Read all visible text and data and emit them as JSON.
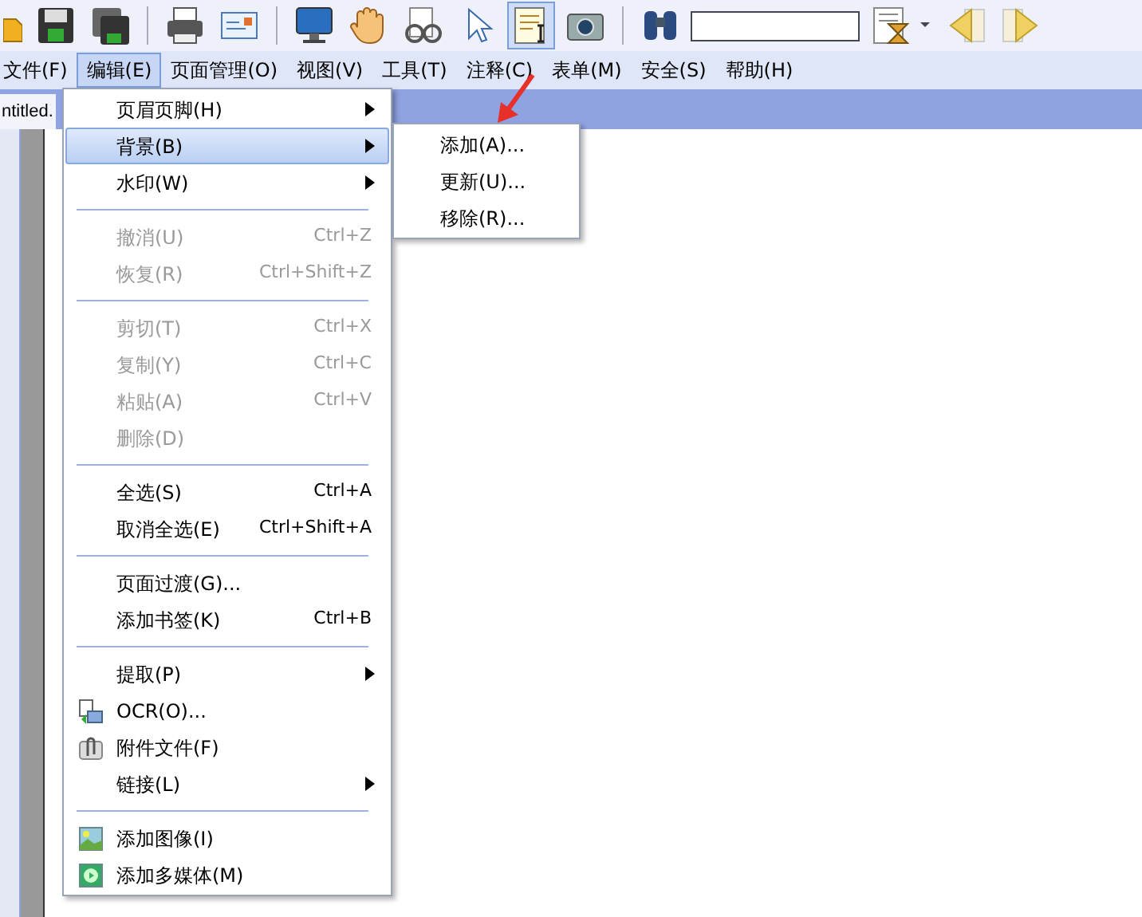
{
  "toolbar": {
    "tools": [
      {
        "kind": "folder",
        "selected": false
      },
      {
        "kind": "save",
        "selected": false
      },
      {
        "kind": "save-all",
        "selected": false
      },
      {
        "kind": "sep"
      },
      {
        "kind": "print",
        "selected": false
      },
      {
        "kind": "mail",
        "selected": false
      },
      {
        "kind": "sep"
      },
      {
        "kind": "monitor",
        "selected": false
      },
      {
        "kind": "hand",
        "selected": false
      },
      {
        "kind": "glasses",
        "selected": false
      },
      {
        "kind": "pointer",
        "selected": false
      },
      {
        "kind": "text-select",
        "selected": true
      },
      {
        "kind": "camera",
        "selected": false
      },
      {
        "kind": "sep"
      },
      {
        "kind": "binoculars",
        "selected": false
      },
      {
        "kind": "search"
      },
      {
        "kind": "hourglass",
        "selected": false
      },
      {
        "kind": "prev",
        "selected": false
      },
      {
        "kind": "next",
        "selected": false
      }
    ]
  },
  "menubar": [
    {
      "label": "文件(F)",
      "selected": false
    },
    {
      "label": "编辑(E)",
      "selected": true
    },
    {
      "label": "页面管理(O)",
      "selected": false
    },
    {
      "label": "视图(V)",
      "selected": false
    },
    {
      "label": "工具(T)",
      "selected": false
    },
    {
      "label": "注释(C)",
      "selected": false
    },
    {
      "label": "表单(M)",
      "selected": false
    },
    {
      "label": "安全(S)",
      "selected": false
    },
    {
      "label": "帮助(H)",
      "selected": false
    }
  ],
  "tab": {
    "label": "ntitled."
  },
  "menu": [
    {
      "kind": "item",
      "label": "页眉页脚(H)",
      "submenu": true,
      "disabled": false,
      "selected": false
    },
    {
      "kind": "item",
      "label": "背景(B)",
      "submenu": true,
      "disabled": false,
      "selected": true
    },
    {
      "kind": "item",
      "label": "水印(W)",
      "submenu": true,
      "disabled": false,
      "selected": false
    },
    {
      "kind": "separator"
    },
    {
      "kind": "item",
      "label": "撤消(U)",
      "shortcut": "Ctrl+Z",
      "submenu": false,
      "disabled": true,
      "selected": false
    },
    {
      "kind": "item",
      "label": "恢复(R)",
      "shortcut": "Ctrl+Shift+Z",
      "submenu": false,
      "disabled": true,
      "selected": false
    },
    {
      "kind": "separator"
    },
    {
      "kind": "item",
      "label": "剪切(T)",
      "shortcut": "Ctrl+X",
      "submenu": false,
      "disabled": true,
      "selected": false
    },
    {
      "kind": "item",
      "label": "复制(Y)",
      "shortcut": "Ctrl+C",
      "submenu": false,
      "disabled": true,
      "selected": false
    },
    {
      "kind": "item",
      "label": "粘贴(A)",
      "shortcut": "Ctrl+V",
      "submenu": false,
      "disabled": true,
      "selected": false
    },
    {
      "kind": "item",
      "label": "删除(D)",
      "submenu": false,
      "disabled": true,
      "selected": false
    },
    {
      "kind": "separator"
    },
    {
      "kind": "item",
      "label": "全选(S)",
      "shortcut": "Ctrl+A",
      "submenu": false,
      "disabled": false,
      "selected": false
    },
    {
      "kind": "item",
      "label": "取消全选(E)",
      "shortcut": "Ctrl+Shift+A",
      "submenu": false,
      "disabled": false,
      "selected": false
    },
    {
      "kind": "separator"
    },
    {
      "kind": "item",
      "label": "页面过渡(G)...",
      "submenu": false,
      "disabled": false,
      "selected": false
    },
    {
      "kind": "item",
      "label": "添加书签(K)",
      "shortcut": "Ctrl+B",
      "submenu": false,
      "disabled": false,
      "selected": false
    },
    {
      "kind": "separator"
    },
    {
      "kind": "item",
      "label": "提取(P)",
      "submenu": true,
      "disabled": false,
      "selected": false
    },
    {
      "kind": "icon-item",
      "label": "OCR(O)...",
      "submenu": false,
      "disabled": false,
      "selected": false
    },
    {
      "kind": "icon-item",
      "label": "附件文件(F)",
      "submenu": false,
      "disabled": false,
      "selected": false
    },
    {
      "kind": "item",
      "label": "链接(L)",
      "submenu": true,
      "disabled": false,
      "selected": false
    },
    {
      "kind": "separator"
    },
    {
      "kind": "icon-item",
      "label": "添加图像(I)",
      "submenu": false,
      "disabled": false,
      "selected": false
    },
    {
      "kind": "icon-item",
      "label": "添加多媒体(M)",
      "submenu": false,
      "disabled": false,
      "selected": false
    }
  ],
  "submenu": [
    {
      "label": "添加(A)..."
    },
    {
      "label": "更新(U)..."
    },
    {
      "label": "移除(R)..."
    }
  ]
}
